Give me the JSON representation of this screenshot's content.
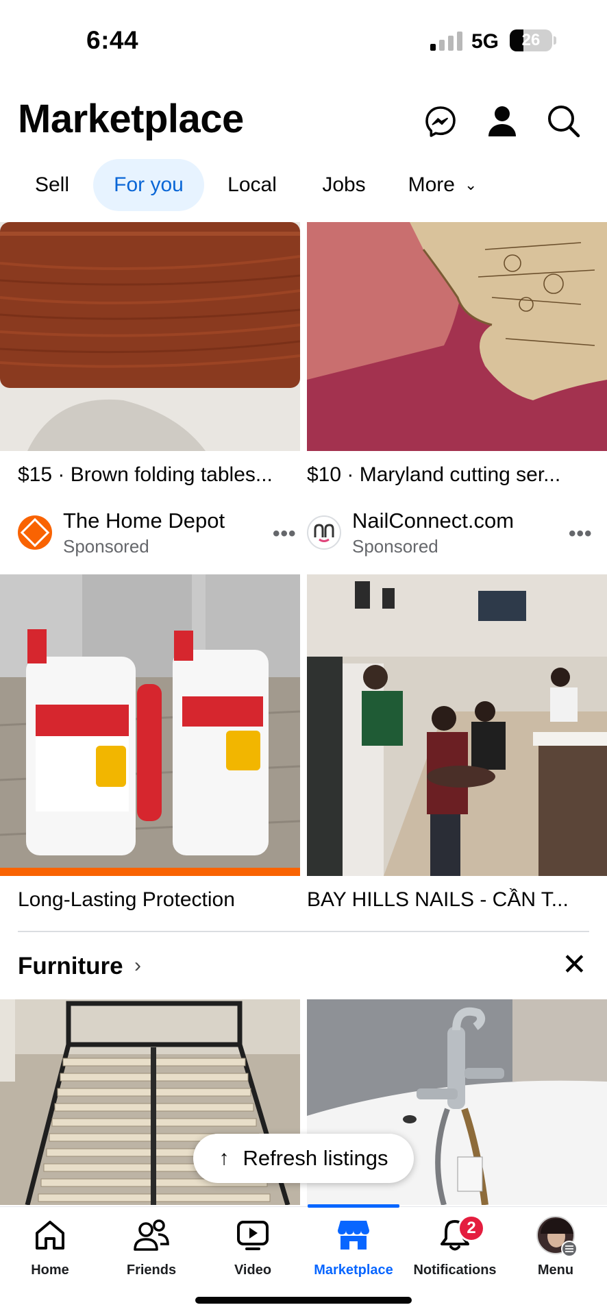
{
  "status_bar": {
    "time": "6:44",
    "network": "5G",
    "battery": "26"
  },
  "header": {
    "title": "Marketplace"
  },
  "tabs": [
    {
      "label": "Sell"
    },
    {
      "label": "For you"
    },
    {
      "label": "Local"
    },
    {
      "label": "Jobs"
    },
    {
      "label": "More"
    }
  ],
  "listings": [
    {
      "title": "$15 · Brown folding tables..."
    },
    {
      "title": "$10 · Maryland cutting ser..."
    }
  ],
  "ads": [
    {
      "seller": "The Home Depot",
      "tag": "Sponsored",
      "more": "•••",
      "title": "Long-Lasting Protection"
    },
    {
      "seller": "NailConnect.com",
      "tag": "Sponsored",
      "more": "•••",
      "title": "BAY HILLS NAILS - CẦN T..."
    }
  ],
  "furniture": {
    "title": "Furniture",
    "chevron": "›",
    "close": "✕"
  },
  "refresh": {
    "label": "Refresh listings",
    "arrow": "↑"
  },
  "bottom_nav": [
    {
      "label": "Home"
    },
    {
      "label": "Friends"
    },
    {
      "label": "Video"
    },
    {
      "label": "Marketplace"
    },
    {
      "label": "Notifications",
      "badge": "2"
    },
    {
      "label": "Menu"
    }
  ],
  "colors": {
    "accent": "#0866ff",
    "tab_active_bg": "#e7f3ff",
    "badge": "#e41e3f",
    "secondary_text": "#65676b"
  }
}
